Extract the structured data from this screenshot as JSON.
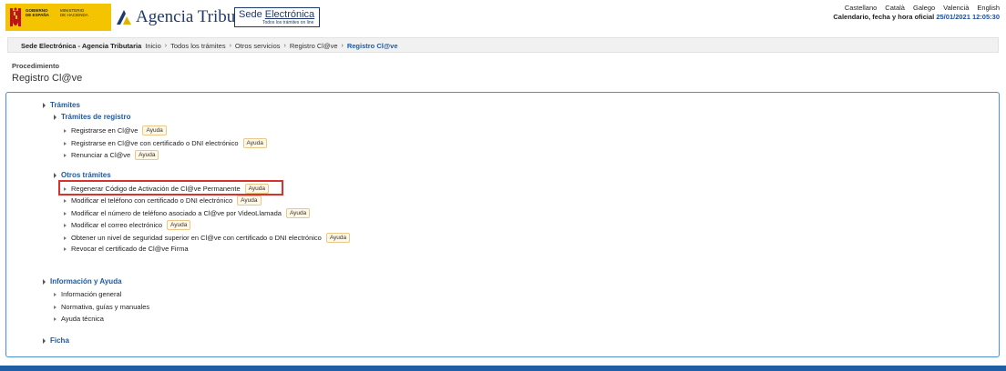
{
  "header": {
    "gov_logo": {
      "line1": "GOBIERNO\nDE ESPAÑA",
      "line2": "MINISTERIO\nDE HACIENDA",
      "color": "#f5c400"
    },
    "agency_name": "Agencia Tributaria",
    "sede": {
      "prefix": "Sede ",
      "emph": "Electrónica",
      "tagline": "Todos los trámites on line"
    },
    "languages": [
      "Castellano",
      "Català",
      "Galego",
      "Valencià",
      "English"
    ],
    "datetime_label": "Calendario, fecha y hora oficial",
    "datetime_value": "25/01/2021 12:05:30"
  },
  "breadcrumb": {
    "first": "Sede Electrónica - Agencia Tributaria",
    "items": [
      "Inicio",
      "Todos los trámites",
      "Otros servicios",
      "Registro Cl@ve"
    ],
    "current": "Registro Cl@ve"
  },
  "page": {
    "label": "Procedimiento",
    "title": "Registro Cl@ve"
  },
  "tree": {
    "tramites": "Trámites",
    "registro": {
      "label": "Trámites de registro",
      "items": [
        {
          "label": "Registrarse en Cl@ve",
          "ayuda": "Ayuda"
        },
        {
          "label": "Registrarse en Cl@ve con certificado o DNI electrónico",
          "ayuda": "Ayuda"
        },
        {
          "label": "Renunciar a Cl@ve",
          "ayuda": "Ayuda"
        }
      ]
    },
    "otros": {
      "label": "Otros trámites",
      "items": [
        {
          "label": "Regenerar Código de Activación de Cl@ve Permanente",
          "ayuda": "Ayuda"
        },
        {
          "label": "Modificar el teléfono con certificado o DNI electrónico",
          "ayuda": "Ayuda"
        },
        {
          "label": "Modificar el número de teléfono asociado a Cl@ve por VideoLlamada",
          "ayuda": "Ayuda"
        },
        {
          "label": "Modificar el correo electrónico",
          "ayuda": "Ayuda"
        },
        {
          "label": "Obtener un nivel de seguridad superior en Cl@ve con certificado o DNI electrónico",
          "ayuda": "Ayuda"
        },
        {
          "label": "Revocar el certificado de Cl@ve Firma"
        }
      ]
    },
    "info": {
      "label": "Información y Ayuda",
      "items": [
        "Información general",
        "Normativa, guías y manuales",
        "Ayuda técnica"
      ]
    },
    "ficha": "Ficha"
  },
  "colors": {
    "link_blue": "#1f5aa0",
    "box_border": "#4d8fcf",
    "highlight": "#d9312b",
    "footer": "#1d5ea6"
  }
}
